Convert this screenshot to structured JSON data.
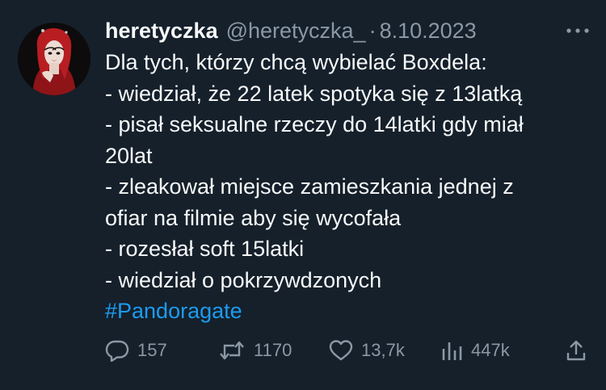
{
  "tweet": {
    "author_name": "heretyczka",
    "author_handle": "@heretyczka_",
    "separator": "·",
    "date": "8.10.2023",
    "more_label": "•••",
    "lines": [
      "Dla tych, którzy chcą wybielać Boxdela:",
      "- wiedział, że 22 latek spotyka się z 13latką",
      "- pisał seksualne rzeczy do 14latki gdy miał",
      "20lat",
      "- zleakował miejsce zamieszkania jednej z",
      "ofiar na filmie aby się wycofała",
      "- rozesłał soft 15latki",
      "- wiedział o pokrzywdzonych"
    ],
    "hashtag": "#Pandoragate"
  },
  "actions": {
    "replies": "157",
    "retweets": "1170",
    "likes": "13,7k",
    "views": "447k"
  },
  "colors": {
    "background": "#15202b",
    "text": "#f7f9f9",
    "muted": "#8b98a5",
    "link": "#1d9bf0"
  },
  "icons": [
    "reply-icon",
    "retweet-icon",
    "like-icon",
    "views-icon",
    "share-icon",
    "more-icon"
  ]
}
